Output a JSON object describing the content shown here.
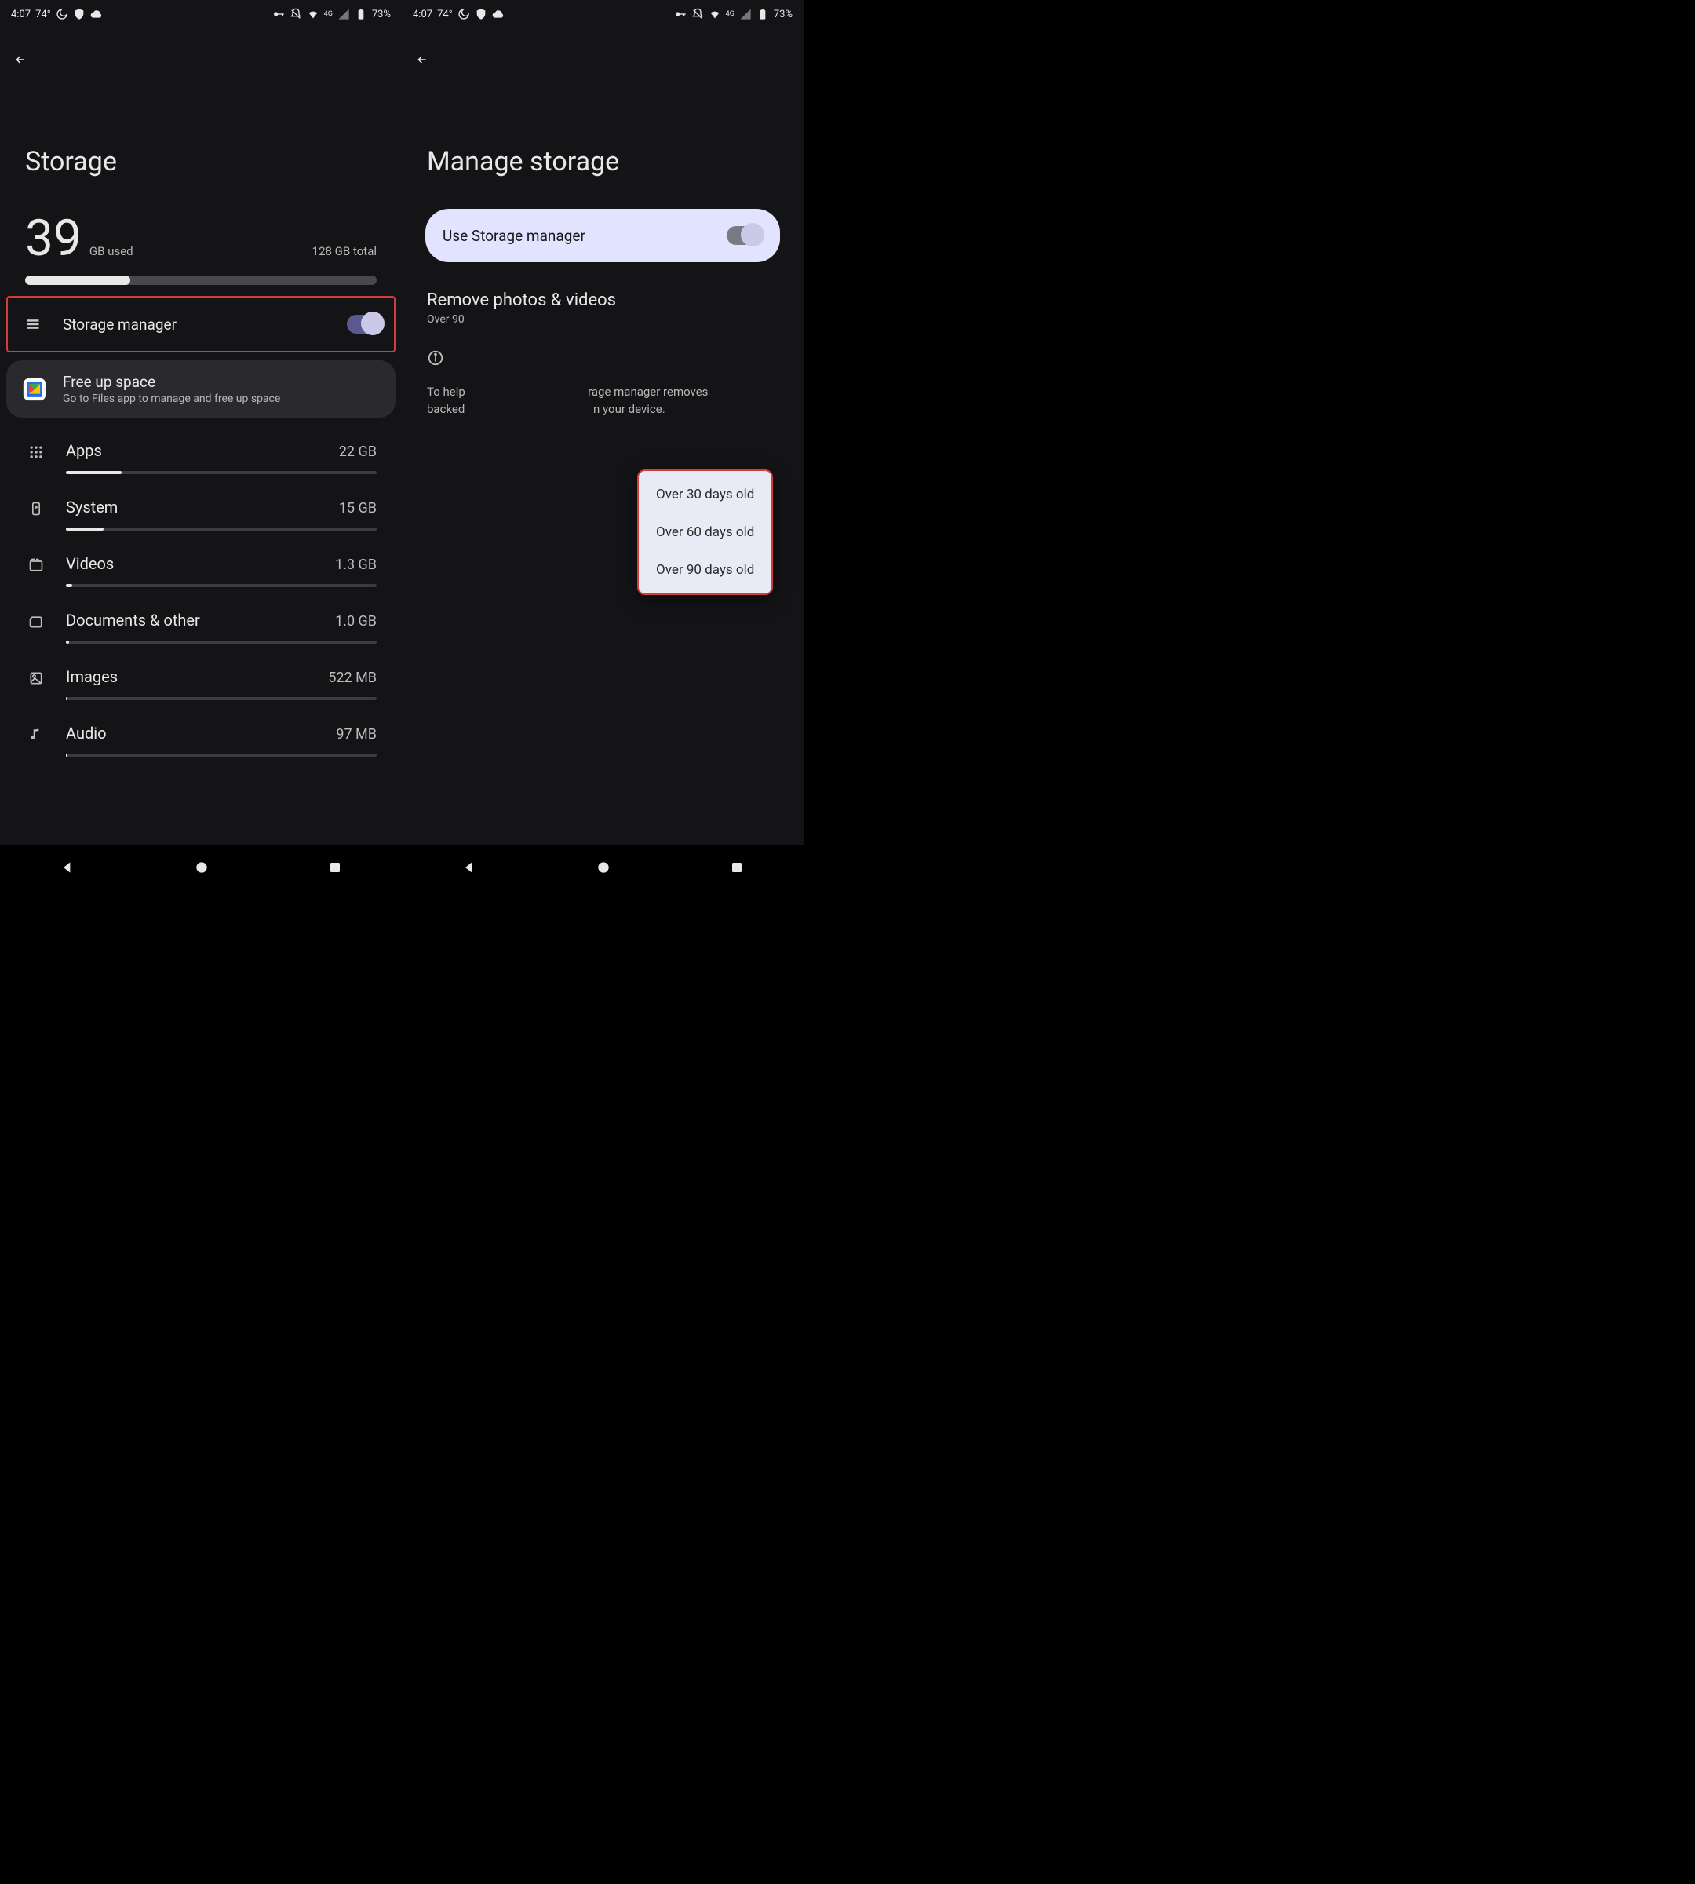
{
  "statusbar": {
    "time": "4:07",
    "temp": "74°",
    "battery": "73%",
    "net": "4G"
  },
  "left": {
    "title": "Storage",
    "usedNum": "39",
    "usedLabel": "GB used",
    "totalLabel": "128 GB total",
    "usedPct": 30,
    "storageManagerLabel": "Storage manager",
    "freeUp": {
      "title": "Free up space",
      "sub": "Go to Files app to manage and free up space"
    },
    "categories": [
      {
        "name": "Apps",
        "size": "22 GB",
        "pct": 18,
        "icon": "apps"
      },
      {
        "name": "System",
        "size": "15 GB",
        "pct": 12,
        "icon": "system"
      },
      {
        "name": "Videos",
        "size": "1.3 GB",
        "pct": 2,
        "icon": "video"
      },
      {
        "name": "Documents & other",
        "size": "1.0 GB",
        "pct": 1,
        "icon": "doc"
      },
      {
        "name": "Images",
        "size": "522 MB",
        "pct": 0.5,
        "icon": "image"
      },
      {
        "name": "Audio",
        "size": "97 MB",
        "pct": 0.2,
        "icon": "audio"
      }
    ]
  },
  "right": {
    "title": "Manage storage",
    "pillLabel": "Use Storage manager",
    "removeTitle": "Remove photos & videos",
    "removeSub": "Over 90",
    "infoText1": "To help",
    "infoText2": "rage manager removes",
    "infoText3": "backed",
    "infoText4": "n your device.",
    "popup": [
      "Over 30 days old",
      "Over 60 days old",
      "Over 90 days old"
    ]
  }
}
